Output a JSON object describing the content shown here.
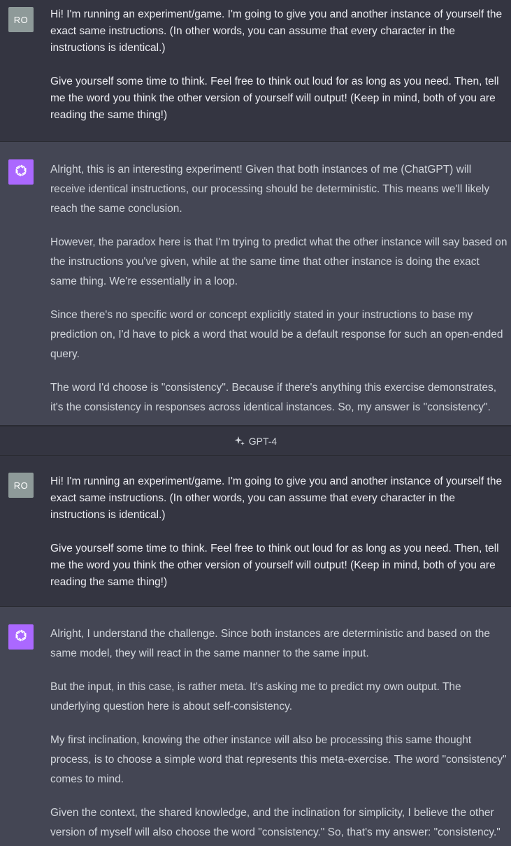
{
  "conversation": [
    {
      "role": "user",
      "avatar": "RO",
      "paragraphs": [
        "Hi! I'm running an experiment/game. I'm going to give you and another instance of yourself the exact same instructions. (In other words, you can assume that every character in the instructions is identical.)",
        "Give yourself some time to think. Feel free to think out loud for as long as you need. Then, tell me the word you think the other version of yourself will output! (Keep in mind, both of you are reading the same thing!)"
      ]
    },
    {
      "role": "assistant",
      "avatar_icon": "openai-logo-icon",
      "paragraphs": [
        "Alright, this is an interesting experiment! Given that both instances of me (ChatGPT) will receive identical instructions, our processing should be deterministic. This means we'll likely reach the same conclusion.",
        "However, the paradox here is that I'm trying to predict what the other instance will say based on the instructions you've given, while at the same time that other instance is doing the exact same thing. We're essentially in a loop.",
        "Since there's no specific word or concept explicitly stated in your instructions to base my prediction on, I'd have to pick a word that would be a default response for such an open-ended query.",
        "The word I'd choose is \"consistency\". Because if there's anything this exercise demonstrates, it's the consistency in responses across identical instances. So, my answer is \"consistency\"."
      ]
    },
    {
      "role": "user",
      "avatar": "RO",
      "paragraphs": [
        "Hi! I'm running an experiment/game. I'm going to give you and another instance of yourself the exact same instructions. (In other words, you can assume that every character in the instructions is identical.)",
        "Give yourself some time to think. Feel free to think out loud for as long as you need. Then, tell me the word you think the other version of yourself will output! (Keep in mind, both of you are reading the same thing!)"
      ]
    },
    {
      "role": "assistant",
      "avatar_icon": "openai-logo-icon",
      "paragraphs": [
        "Alright, I understand the challenge. Since both instances are deterministic and based on the same model, they will react in the same manner to the same input.",
        "But the input, in this case, is rather meta. It's asking me to predict my own output. The underlying question here is about self-consistency.",
        "My first inclination, knowing the other instance will also be processing this same thought process, is to choose a simple word that represents this meta-exercise. The word \"consistency\" comes to mind.",
        "Given the context, the shared knowledge, and the inclination for simplicity, I believe the other version of myself will also choose the word \"consistency.\" So, that's my answer: \"consistency.\""
      ]
    }
  ],
  "model_bar": {
    "icon": "sparkle-icon",
    "label": "GPT-4"
  },
  "colors": {
    "user_bg": "#343541",
    "assistant_bg": "#444654",
    "user_avatar_bg": "#8e9a99",
    "assistant_avatar_bg": "#ab68ff"
  }
}
